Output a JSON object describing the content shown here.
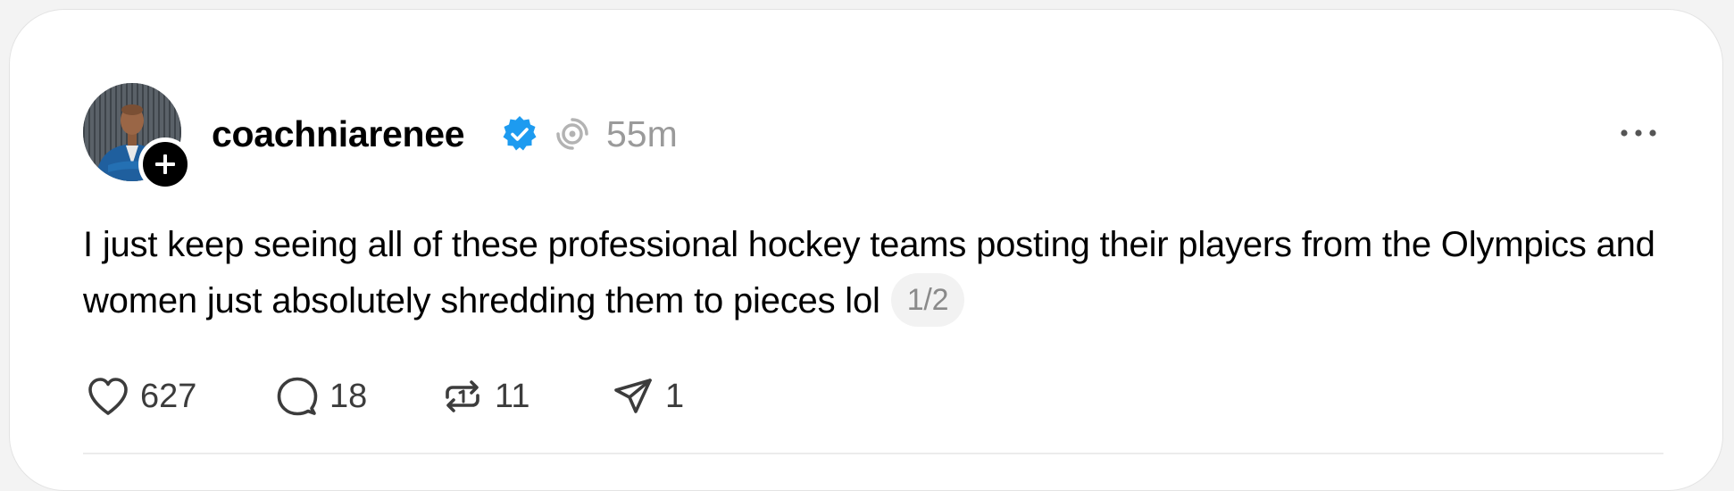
{
  "post": {
    "username": "coachniarenee",
    "time": "55m",
    "text": "I just keep seeing all of these professional hockey teams posting their players from the Olympics and women just absolutely shredding them to pieces lol",
    "page_indicator": "1/2"
  },
  "actions": {
    "likes": "627",
    "replies": "18",
    "reposts": "11",
    "shares": "1"
  },
  "icons": {
    "verified": "verified-badge-icon",
    "thread": "thread-circle-icon",
    "more": "more-horizontal-icon",
    "like": "heart-icon",
    "reply": "comment-bubble-icon",
    "repost": "repost-icon",
    "share": "send-icon",
    "follow": "plus-icon"
  },
  "colors": {
    "verified": "#1d9bf0",
    "muted": "#9a9a9a",
    "text": "#000000"
  }
}
